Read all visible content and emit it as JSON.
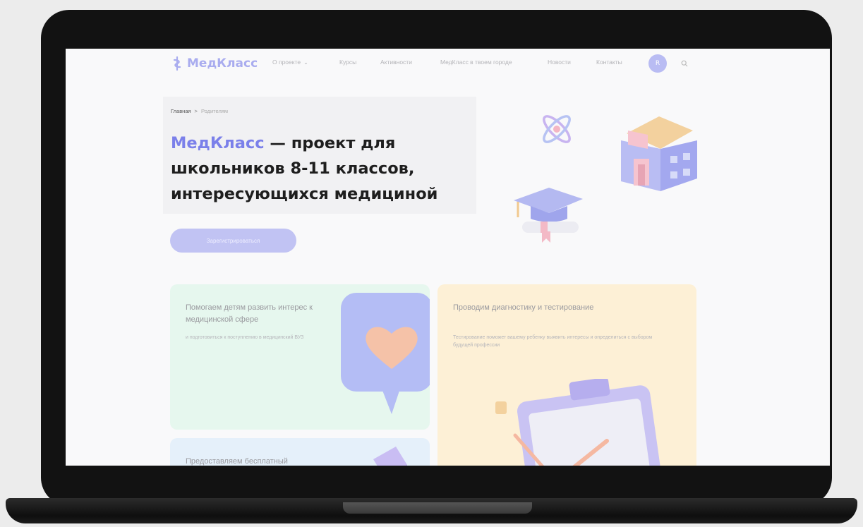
{
  "nav": {
    "logo_text": "МедКласс",
    "links": [
      "О проекте",
      "Курсы",
      "Активности",
      "МедКласс в твоем городе",
      "Новости",
      "Контакты"
    ],
    "avatar_initial": "R"
  },
  "breadcrumb": {
    "home": "Главная",
    "separator": ">",
    "current": "Родителям"
  },
  "hero": {
    "title_accent": "МедКласс",
    "title_rest": " — проект для школьников 8-11 классов, интересующихся медициной",
    "cta_label": "Зарегистрироваться"
  },
  "cards": [
    {
      "title": "Помогаем детям развить интерес к медицинской сфере",
      "desc": "и подготовиться к поступлению в медицинский ВУЗ"
    },
    {
      "title": "Проводим диагностику и тестирование",
      "desc": "Тестирование поможет вашему ребенку выявить интересы и определиться с выбором будущей профессии"
    },
    {
      "title": "Предоставляем бесплатный",
      "desc": ""
    }
  ],
  "colors": {
    "accent": "#7b80ea",
    "card_green": "#e6f7ee",
    "card_yellow": "#fdf0d6",
    "card_blue": "#e5f0fa"
  }
}
